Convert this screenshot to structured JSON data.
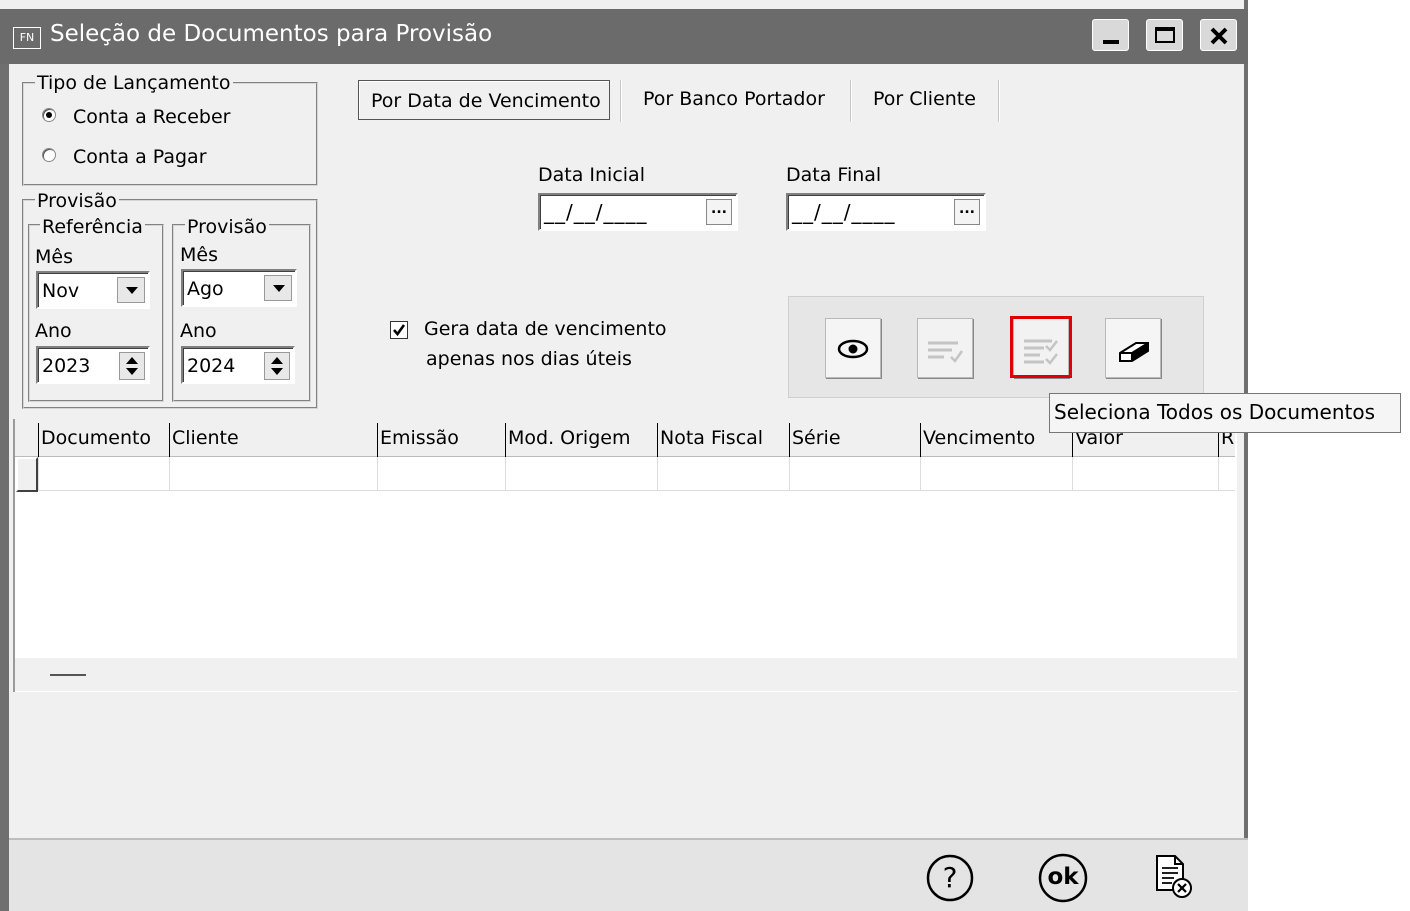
{
  "window": {
    "app_badge": "FN",
    "title": "Seleção de Documentos para Provisão"
  },
  "tipo_lancamento": {
    "legend": "Tipo de Lançamento",
    "options": [
      {
        "label": "Conta a Receber",
        "selected": true
      },
      {
        "label": "Conta a Pagar",
        "selected": false
      }
    ]
  },
  "provisao": {
    "legend": "Provisão",
    "referencia": {
      "legend": "Referência",
      "mes_label": "Mês",
      "mes_value": "Nov",
      "ano_label": "Ano",
      "ano_value": "2023"
    },
    "provisao": {
      "legend": "Provisão",
      "mes_label": "Mês",
      "mes_value": "Ago",
      "ano_label": "Ano",
      "ano_value": "2024"
    }
  },
  "tabs": [
    {
      "label": "Por Data de Vencimento",
      "active": true
    },
    {
      "label": "Por Banco Portador",
      "active": false
    },
    {
      "label": "Por Cliente",
      "active": false
    }
  ],
  "dates": {
    "inicial_label": "Data Inicial",
    "inicial_value": "__/__/____",
    "final_label": "Data Final",
    "final_value": "__/__/____",
    "picker_glyph": "..."
  },
  "checkbox": {
    "line1": "Gera data de vencimento",
    "line2": "apenas nos dias úteis",
    "checked": true
  },
  "toolbar": {
    "tooltip": "Seleciona Todos os Documentos",
    "buttons": [
      {
        "icon": "eye-icon",
        "enabled": true
      },
      {
        "icon": "select-icon",
        "enabled": false
      },
      {
        "icon": "select-all-icon",
        "enabled": false,
        "highlighted": true
      },
      {
        "icon": "eraser-icon",
        "enabled": true
      }
    ],
    "highlight_color": "#e00000"
  },
  "grid": {
    "columns": [
      "Documento",
      "Cliente",
      "Emissão",
      "Mod. Origem",
      "Nota Fiscal",
      "Série",
      "Vencimento",
      "Valor",
      "R"
    ]
  },
  "footer": {
    "help_glyph": "?",
    "ok_label": "ok"
  }
}
